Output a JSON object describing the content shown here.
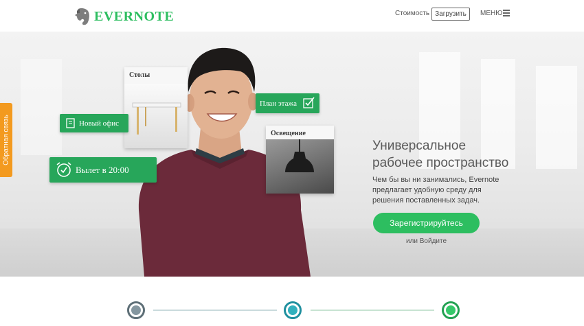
{
  "header": {
    "logo_text": "EVERNOTE",
    "nav": {
      "pricing": "Стоимость",
      "download": "Загрузить",
      "menu": "МЕНЮ"
    }
  },
  "feedback": {
    "label": "Обратная связь"
  },
  "hero": {
    "cards": {
      "office": "Новый офис",
      "floor_plan": "План этажа",
      "flight": "Вылет в 20:00",
      "tables": "Столы",
      "lighting": "Освещение"
    },
    "headline_line1": "Универсальное",
    "headline_line2": "рабочее пространство",
    "lead_line1": "Чем бы вы ни занимались, Evernote",
    "lead_line2": "предлагает удобную среду для",
    "lead_line3": "решения поставленных задач.",
    "signup": "Зарегистрируйтесь",
    "login": "или Войдите"
  },
  "colors": {
    "brand": "#2dbe60",
    "feedback": "#f39a1f",
    "card_green": "#27a65a"
  }
}
